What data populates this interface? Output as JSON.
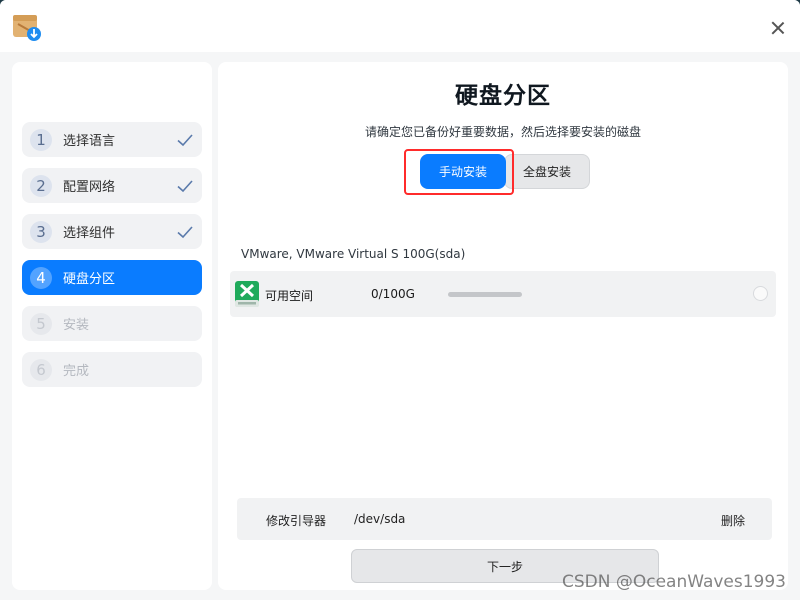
{
  "steps": [
    {
      "num": "1",
      "label": "选择语言",
      "state": "done"
    },
    {
      "num": "2",
      "label": "配置网络",
      "state": "done"
    },
    {
      "num": "3",
      "label": "选择组件",
      "state": "done"
    },
    {
      "num": "4",
      "label": "硬盘分区",
      "state": "active"
    },
    {
      "num": "5",
      "label": "安装",
      "state": "disabled"
    },
    {
      "num": "6",
      "label": "完成",
      "state": "disabled"
    }
  ],
  "main": {
    "title": "硬盘分区",
    "subtitle": "请确定您已备份好重要数据，然后选择要安装的磁盘",
    "mode_manual": "手动安装",
    "mode_full": "全盘安装",
    "disk_name": "VMware, VMware Virtual S 100G(sda)",
    "disk": {
      "label": "可用空间",
      "size": "0/100G",
      "usage_fraction": 0
    },
    "boot": {
      "label": "修改引导器",
      "device": "/dev/sda",
      "delete": "删除"
    },
    "next": "下一步"
  },
  "watermark": "CSDN @OceanWaves1993",
  "colors": {
    "accent": "#0a7cff",
    "highlight": "#ff2b2b",
    "disk_icon": "#1faa5b"
  },
  "icons": {
    "app": "installer-package-icon",
    "close": "close-icon",
    "check": "checkmark-icon",
    "disk": "disk-icon",
    "radio": "radio-icon"
  }
}
